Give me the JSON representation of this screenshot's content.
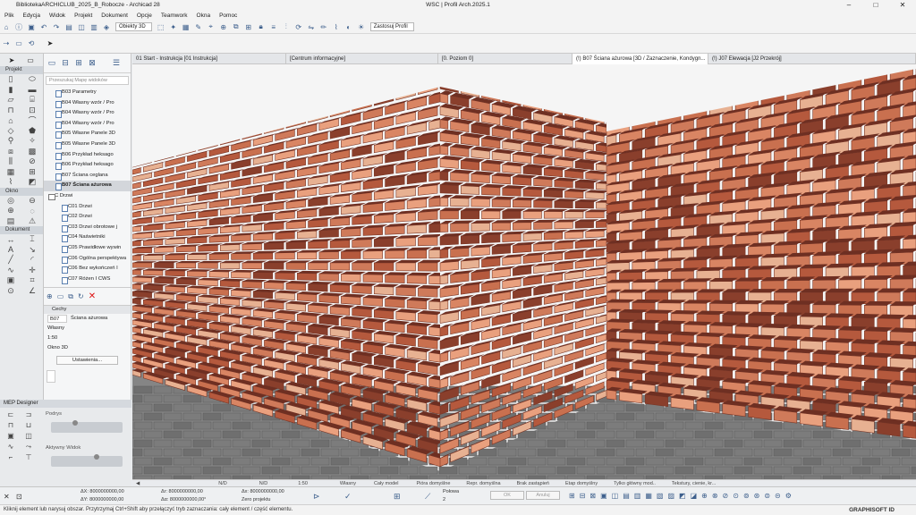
{
  "window": {
    "title": "BibliotekaARCHICLUB_2025_B_Robocze - Archicad 28",
    "center": "WSC | Profil Arch.2025.1"
  },
  "menu": [
    "Plik",
    "Edycja",
    "Widok",
    "Projekt",
    "Dokument",
    "Opcje",
    "Teamwork",
    "Okna",
    "Pomoc"
  ],
  "toolbar": {
    "view_combo": "Obiekty 3D",
    "profile_combo": "Zastosuj Profil"
  },
  "toolbox": {
    "sections": [
      "Projekt",
      "Okno",
      "Dokument"
    ]
  },
  "navigator": {
    "search_placeholder": "Przeszukaj Mapę widoków",
    "items": [
      {
        "label": "B03 Parametry",
        "kind": "item"
      },
      {
        "label": "B04 Własny wzór / Pro",
        "kind": "item"
      },
      {
        "label": "B04 Własny wzór / Pro",
        "kind": "item"
      },
      {
        "label": "B04 Własny wzór / Pro",
        "kind": "item"
      },
      {
        "label": "B05 Własne Panele 3D",
        "kind": "item"
      },
      {
        "label": "B05 Własne Panele 3D",
        "kind": "item"
      },
      {
        "label": "B06 Przykład heksago",
        "kind": "item"
      },
      {
        "label": "B06 Przykład heksago",
        "kind": "item"
      },
      {
        "label": "B07 Ściana ceglana",
        "kind": "item"
      },
      {
        "label": "B07 Ściana ażurowa",
        "kind": "selected"
      },
      {
        "label": "C Drzwi",
        "kind": "folder"
      },
      {
        "label": "C01 Drzwi",
        "kind": "child"
      },
      {
        "label": "C02 Drzwi",
        "kind": "child"
      },
      {
        "label": "C03 Drzwi obrotowe j",
        "kind": "child"
      },
      {
        "label": "C04 Naświetniki",
        "kind": "child"
      },
      {
        "label": "C05 Prawidłowe wywin",
        "kind": "child"
      },
      {
        "label": "C06 Ogólna perspektywa",
        "kind": "child"
      },
      {
        "label": "C06 Bez wykończeń I",
        "kind": "child"
      },
      {
        "label": "C07 Różen I CWS",
        "kind": "child"
      }
    ],
    "properties_header": "Cechy",
    "prop_id": "B07",
    "prop_name": "Ściana ażurowa",
    "prop_owner": "Własny",
    "prop_scale": "1:50",
    "prop_view": "Okno 3D",
    "settings_button": "Ustawienia..."
  },
  "mep": {
    "header": "MEP Designer",
    "label1": "Podrys",
    "label2": "Aktywny Widok"
  },
  "tabs": [
    {
      "label": "01 Start - Instrukcja [01 Instrukcja]",
      "active": false
    },
    {
      "label": "[Centrum informacyjne]",
      "active": false
    },
    {
      "label": "[0. Poziom 0]",
      "active": false
    },
    {
      "label": "(!) B07 Ściana ażurowa [3D / Zaznaczenie, Kondygn...",
      "active": true
    },
    {
      "label": "(!) J07 Elewacja [J2 Przekrój]",
      "active": false
    }
  ],
  "viewbar": [
    "N/D",
    "N/D",
    "1:50",
    "Własny",
    "Cały model",
    "Pióra domyślne",
    "Repr. domyślna",
    "Brak zastąpień",
    "Etap domyślny",
    "Tylko główny mod..",
    "Tekstury, cienie, kr..."
  ],
  "infobar": {
    "ax": "ΔX: 8000000000,00",
    "ay": "ΔY: 8000000000,00",
    "ar": "Δr: 8000000000,00",
    "aa": "Δα: 8000000000,00°",
    "ax2": "Δx: 8000000000,00",
    "zero": "Zero projektu",
    "half": "Połowa",
    "half_val": "2",
    "ok": "OK",
    "cancel": "Anuluj"
  },
  "status": {
    "message": "Kliknij element lub narysuj obszar. Przytrzymaj Ctrl+Shift aby przełączyć tryb zaznaczania: cały element / część elementu.",
    "brand": "GRAPHISOFT ID"
  },
  "colors": {
    "brick_light": "#e9a07e",
    "brick_mid": "#c9704f",
    "brick_dark": "#8a3f2c",
    "pavement": "#7c7c7c"
  }
}
